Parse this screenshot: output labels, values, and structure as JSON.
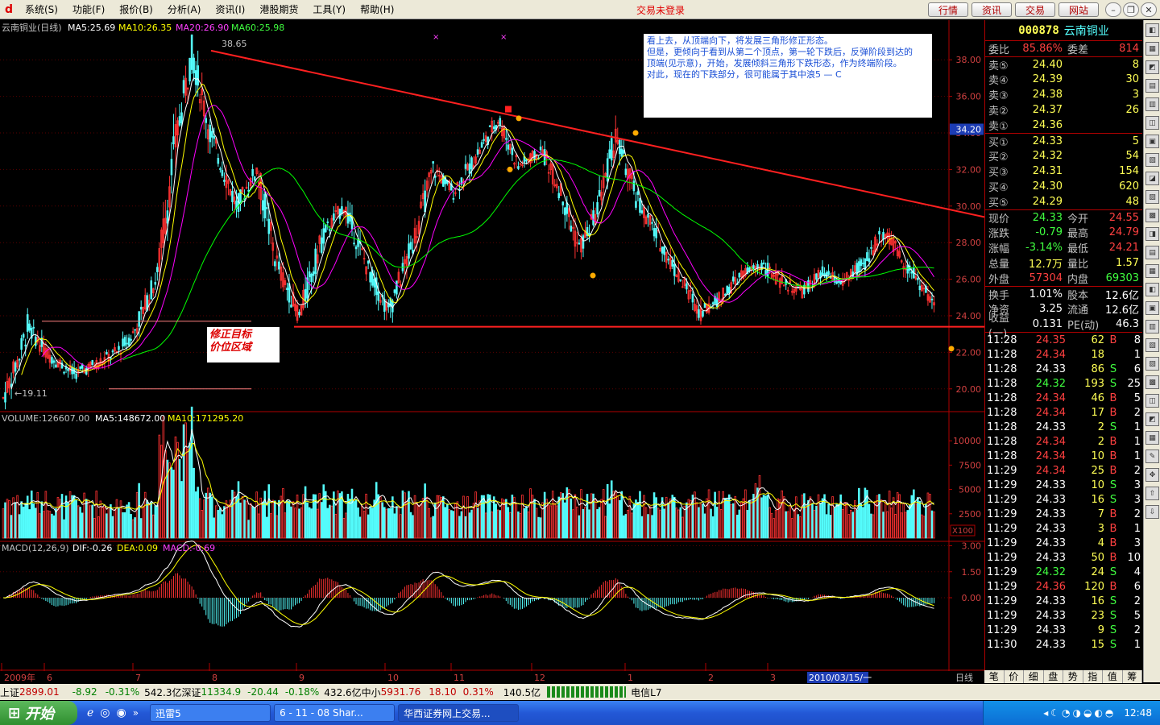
{
  "menu": {
    "items": [
      "系统(S)",
      "功能(F)",
      "报价(B)",
      "分析(A)",
      "资讯(I)",
      "港股期货",
      "工具(Y)",
      "帮助(H)"
    ],
    "status": "交易未登录",
    "buttons": [
      "行情",
      "资讯",
      "交易",
      "网站"
    ]
  },
  "chart_data": {
    "type": "stock-kline",
    "title": "云南铜业(日线)",
    "ma": {
      "ma5": "MA5:25.69",
      "ma10": "MA10:26.35",
      "ma20": "MA20:26.90",
      "ma60": "MA60:25.98"
    },
    "price_axis": {
      "ticks": [
        "38.00",
        "36.00",
        "34.00",
        "32.00",
        "30.00",
        "28.00",
        "26.00",
        "24.00",
        "22.00",
        "20.00"
      ],
      "ylim": [
        18.8,
        39.2
      ],
      "current_marker": "34.20"
    },
    "high_label": "38.65",
    "low_label": "19.11",
    "volume": {
      "header": "VOLUME:126607.00",
      "ma5": "MA5:148672.00",
      "ma10": "MA10:171295.20",
      "ticks": [
        "10000",
        "7500",
        "5000",
        "2500"
      ],
      "unit": "X100"
    },
    "macd": {
      "header": "MACD(12,26,9)",
      "dif": "DIF:-0.26",
      "dea": "DEA:0.09",
      "macd": "MACD:-0.69",
      "ticks": [
        "3.00",
        "1.50",
        "0.00"
      ]
    },
    "xaxis": {
      "labels": [
        "2009年",
        "6",
        "7",
        "8",
        "9",
        "10",
        "11",
        "12",
        "1",
        "2",
        "3"
      ],
      "cursor_date": "2010/03/15/一",
      "period": "日线"
    },
    "colors": {
      "up": "#ff3232",
      "down": "#54fcfc",
      "ma5": "#ffffff",
      "ma10": "#ffff00",
      "ma20": "#ff00ff",
      "ma60": "#00ff00",
      "trend": "#ff2020"
    },
    "waypoints": [
      [
        0,
        19.5
      ],
      [
        8,
        21.8
      ],
      [
        12,
        23.4
      ],
      [
        22,
        21.9
      ],
      [
        35,
        20.8
      ],
      [
        48,
        21.5
      ],
      [
        56,
        22.0
      ],
      [
        64,
        23.0
      ],
      [
        76,
        26.2
      ],
      [
        85,
        33.5
      ],
      [
        93,
        38.4
      ],
      [
        102,
        34.0
      ],
      [
        115,
        30.0
      ],
      [
        125,
        32.0
      ],
      [
        135,
        26.8
      ],
      [
        146,
        24.0
      ],
      [
        158,
        28.5
      ],
      [
        168,
        30.0
      ],
      [
        180,
        26.5
      ],
      [
        190,
        24.2
      ],
      [
        202,
        28.0
      ],
      [
        212,
        32.0
      ],
      [
        222,
        30.8
      ],
      [
        232,
        32.5
      ],
      [
        244,
        34.8
      ],
      [
        254,
        32.2
      ],
      [
        266,
        33.0
      ],
      [
        276,
        30.5
      ],
      [
        284,
        27.6
      ],
      [
        292,
        29.5
      ],
      [
        302,
        33.8
      ],
      [
        312,
        30.5
      ],
      [
        324,
        28.0
      ],
      [
        334,
        26.0
      ],
      [
        344,
        24.2
      ],
      [
        354,
        25.0
      ],
      [
        364,
        26.2
      ],
      [
        374,
        26.8
      ],
      [
        384,
        25.8
      ],
      [
        394,
        25.3
      ],
      [
        404,
        26.3
      ],
      [
        414,
        25.8
      ],
      [
        424,
        26.8
      ],
      [
        434,
        28.6
      ],
      [
        444,
        27.0
      ],
      [
        452,
        25.8
      ],
      [
        460,
        24.4
      ]
    ],
    "n": 460
  },
  "annotation": {
    "lines": [
      "看上去，从顶端向下，将发展三角形修正形态。",
      "但是，更倾向于看到从第二个顶点，第一轮下跌后，反弹阶段到达的",
      "顶端(见示意)，开始，发展倾斜三角形下跌形态，作为终端阶段。",
      "",
      "对此，现在的下跌部分，很可能属于其中浪5 — C"
    ]
  },
  "region_label": [
    "修正目标",
    "价位区域"
  ],
  "quote": {
    "code": "000878",
    "name": "云南铜业",
    "rows_top": [
      {
        "l": "委比",
        "v": "85.86%",
        "l2": "委差",
        "v2": "814"
      }
    ],
    "sells": [
      {
        "l": "卖⑤",
        "p": "24.40",
        "q": "8"
      },
      {
        "l": "卖④",
        "p": "24.39",
        "q": "30"
      },
      {
        "l": "卖③",
        "p": "24.38",
        "q": "3"
      },
      {
        "l": "卖②",
        "p": "24.37",
        "q": "26"
      },
      {
        "l": "卖①",
        "p": "24.36",
        "q": ""
      }
    ],
    "buys": [
      {
        "l": "买①",
        "p": "24.33",
        "q": "5"
      },
      {
        "l": "买②",
        "p": "24.32",
        "q": "54"
      },
      {
        "l": "买③",
        "p": "24.31",
        "q": "154"
      },
      {
        "l": "买④",
        "p": "24.30",
        "q": "620"
      },
      {
        "l": "买⑤",
        "p": "24.29",
        "q": "48"
      }
    ],
    "stats": [
      {
        "l": "现价",
        "v": "24.33",
        "l2": "今开",
        "v2": "24.55"
      },
      {
        "l": "涨跌",
        "v": "-0.79",
        "l2": "最高",
        "v2": "24.79"
      },
      {
        "l": "涨幅",
        "v": "-3.14%",
        "l2": "最低",
        "v2": "24.21"
      },
      {
        "l": "总量",
        "v": "12.7万",
        "l2": "量比",
        "v2": "1.57"
      },
      {
        "l": "外盘",
        "v": "57304",
        "l2": "内盘",
        "v2": "69303"
      }
    ],
    "stats2": [
      {
        "l": "换手",
        "v": "1.01%",
        "l2": "股本",
        "v2": "12.6亿"
      },
      {
        "l": "净资",
        "v": "3.25",
        "l2": "流通",
        "v2": "12.6亿"
      },
      {
        "l": "收益(一)",
        "v": "0.131",
        "l2": "PE(动)",
        "v2": "46.3"
      }
    ],
    "ticks": [
      [
        "11:28",
        "24.35",
        "62",
        "B",
        "8"
      ],
      [
        "11:28",
        "24.34",
        "18",
        "",
        "1"
      ],
      [
        "11:28",
        "24.33",
        "86",
        "S",
        "6"
      ],
      [
        "11:28",
        "24.32",
        "193",
        "S",
        "25"
      ],
      [
        "11:28",
        "24.34",
        "46",
        "B",
        "5"
      ],
      [
        "11:28",
        "24.34",
        "17",
        "B",
        "2"
      ],
      [
        "11:28",
        "24.33",
        "2",
        "S",
        "1"
      ],
      [
        "11:28",
        "24.34",
        "2",
        "B",
        "1"
      ],
      [
        "11:28",
        "24.34",
        "10",
        "B",
        "1"
      ],
      [
        "11:29",
        "24.34",
        "25",
        "B",
        "2"
      ],
      [
        "11:29",
        "24.33",
        "10",
        "S",
        "3"
      ],
      [
        "11:29",
        "24.33",
        "16",
        "S",
        "3"
      ],
      [
        "11:29",
        "24.33",
        "7",
        "B",
        "2"
      ],
      [
        "11:29",
        "24.33",
        "3",
        "B",
        "1"
      ],
      [
        "11:29",
        "24.33",
        "4",
        "B",
        "3"
      ],
      [
        "11:29",
        "24.33",
        "50",
        "B",
        "10"
      ],
      [
        "11:29",
        "24.32",
        "24",
        "S",
        "4"
      ],
      [
        "11:29",
        "24.36",
        "120",
        "B",
        "6"
      ],
      [
        "11:29",
        "24.33",
        "16",
        "S",
        "2"
      ],
      [
        "11:29",
        "24.33",
        "23",
        "S",
        "5"
      ],
      [
        "11:29",
        "24.33",
        "9",
        "S",
        "2"
      ],
      [
        "11:30",
        "24.33",
        "15",
        "S",
        "1"
      ]
    ],
    "tabs": [
      "笔",
      "价",
      "细",
      "盘",
      "势",
      "指",
      "值",
      "筹"
    ]
  },
  "statusbar": {
    "sh_label": "上证",
    "sh": "2899.01",
    "sh_chg": "-8.92",
    "sh_pct": "-0.31%",
    "sh_amt": "542.3亿",
    "sz_label": "深证",
    "sz": "11334.9",
    "sz_chg": "-20.44",
    "sz_pct": "-0.18%",
    "sz_amt": "432.6亿",
    "zx_label": "中小",
    "zx": "5931.76",
    "zx_chg": "18.10",
    "zx_pct": "0.31%",
    "zx_amt": "140.5亿",
    "net": "电信L7"
  },
  "taskbar": {
    "start": "开始",
    "tasks": [
      "迅雷5",
      "6 - 11 - 08 Shar...",
      "华西证券网上交易..."
    ],
    "clock": "12:48"
  }
}
